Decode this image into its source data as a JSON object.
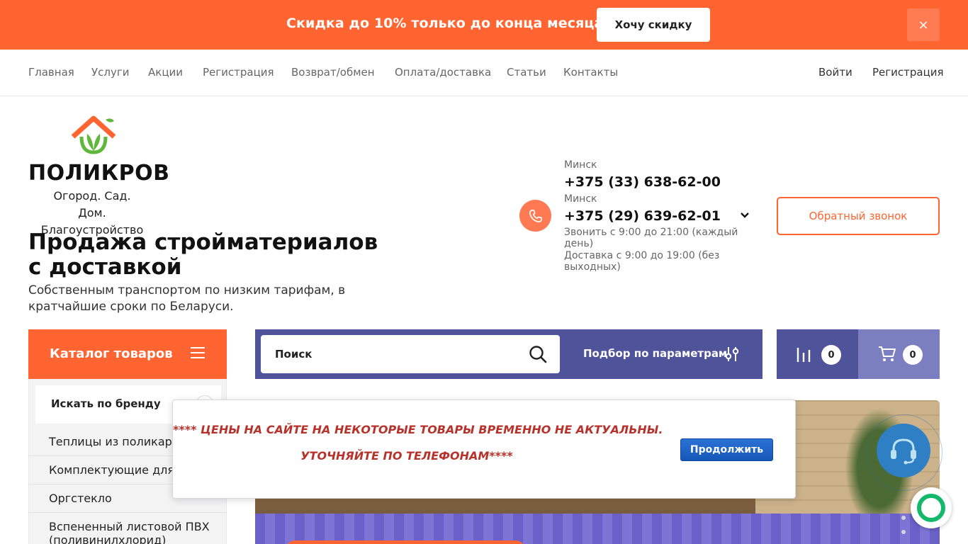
{
  "promo": {
    "text": "Скидка до 10% только до конца месяца",
    "button_label": "Хочу скидку",
    "close_label": "×"
  },
  "nav": {
    "items": [
      "Главная",
      "Услуги",
      "Акции",
      "Регистрация",
      "Возврат/обмен",
      "Оплата/доставка",
      "Статьи",
      "Контакты"
    ],
    "login": "Войти",
    "register": "Регистрация"
  },
  "logo": {
    "name": "ПОЛИКРОВ",
    "tagline": "Огород. Сад. Дом. Благоустройство"
  },
  "hero": {
    "title": "Продажа стройматериалов с доставкой",
    "subtitle": "Собственным транспортом по низким тарифам, в кратчайшие сроки по Беларуси."
  },
  "contacts": {
    "city1": "Минск",
    "phone1": "+375 (33) 638-62-00",
    "city2": "Минск",
    "phone2": "+375 (29) 639-62-01",
    "hours_call": "Звонить с 9:00 до 21:00 (каждый день)",
    "hours_delivery": "Доставка с 9:00 до 19:00 (без выходных)",
    "callback_label": "Обратный звонок"
  },
  "catalog": {
    "title": "Каталог товаров",
    "brand_search": "Искать по бренду",
    "items": [
      "Теплицы из поликарбоната",
      "Комплектующие для теплиц",
      "Оргстекло",
      "Вспененный листовой ПВХ (поливинилхлорид)"
    ]
  },
  "search": {
    "placeholder": "Поиск",
    "params_label": "Подбор по параметрам",
    "compare_count": "0",
    "cart_count": "0"
  },
  "modal": {
    "line1": "**** ЦЕНЫ НА САЙТЕ НА НЕКОТОРЫЕ ТОВАРЫ ВРЕМЕННО НЕ АКТУАЛЬНЫ.",
    "line2": "УТОЧНЯЙТЕ ПО ТЕЛЕФОНАМ****",
    "button_label": "Продолжить"
  },
  "colors": {
    "accent": "#ff6431",
    "nav_blue": "#4f5399",
    "cart_blue": "#7b7fc0",
    "modal_text": "#b7322a",
    "modal_button": "#1f66c9"
  },
  "icons": [
    "close-icon",
    "phone-icon",
    "chevron-down-icon",
    "menu-icon",
    "search-icon",
    "filter-icon",
    "compare-icon",
    "cart-icon",
    "support-headset-icon",
    "chat-icon"
  ]
}
